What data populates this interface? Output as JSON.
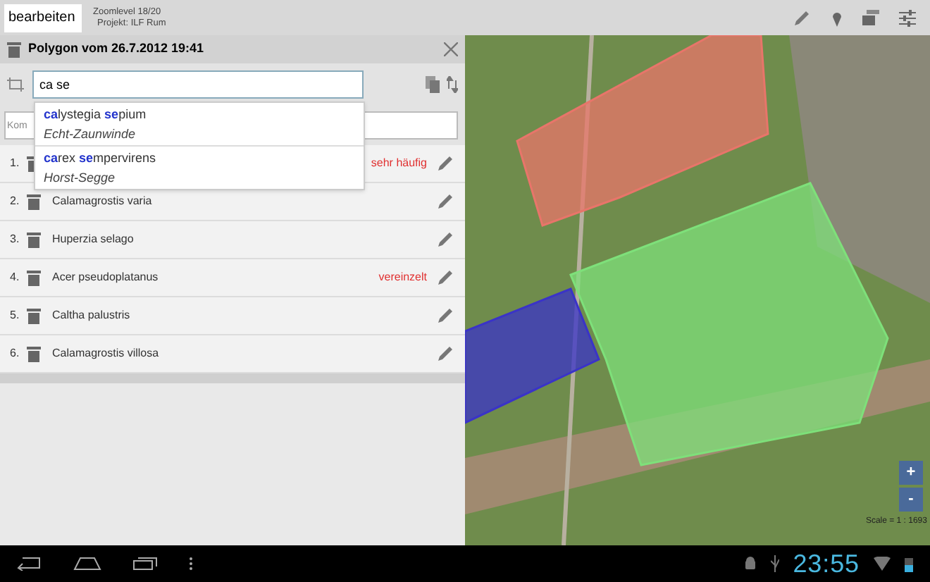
{
  "toolbar": {
    "mode": "bearbeiten",
    "zoomlevel": "Zoomlevel 18/20",
    "project": "Projekt: ILF Rum"
  },
  "panel": {
    "title": "Polygon vom 26.7.2012 19:41",
    "search_value": "ca se",
    "comment_placeholder": "Kom",
    "suggestions": [
      {
        "name": "**ca**lystegia **se**pium",
        "common": "Echt-Zaunwinde"
      },
      {
        "name": "**ca**rex **se**mpervirens",
        "common": "Horst-Segge"
      }
    ],
    "species": [
      {
        "number": "1.",
        "abundance": "sehr häufig"
      },
      {
        "number": "2.",
        "name": "Calamagrostis varia"
      },
      {
        "number": "3.",
        "name": "Huperzia selago"
      },
      {
        "number": "4.",
        "name": "Acer pseudoplatanus",
        "abundance": "vereinzelt"
      },
      {
        "number": "5.",
        "name": "Caltha palustris"
      },
      {
        "number": "6.",
        "name": "Calamagrostis villosa"
      }
    ]
  },
  "map": {
    "zoom_in": "+",
    "zoom_out": "-",
    "scale": "Scale = 1 : 1693",
    "polygons": [
      {
        "color": "#e8756a"
      },
      {
        "color": "#7ee07a"
      },
      {
        "color": "#3a33c8"
      }
    ]
  },
  "status_bar": {
    "time": "23:55"
  }
}
